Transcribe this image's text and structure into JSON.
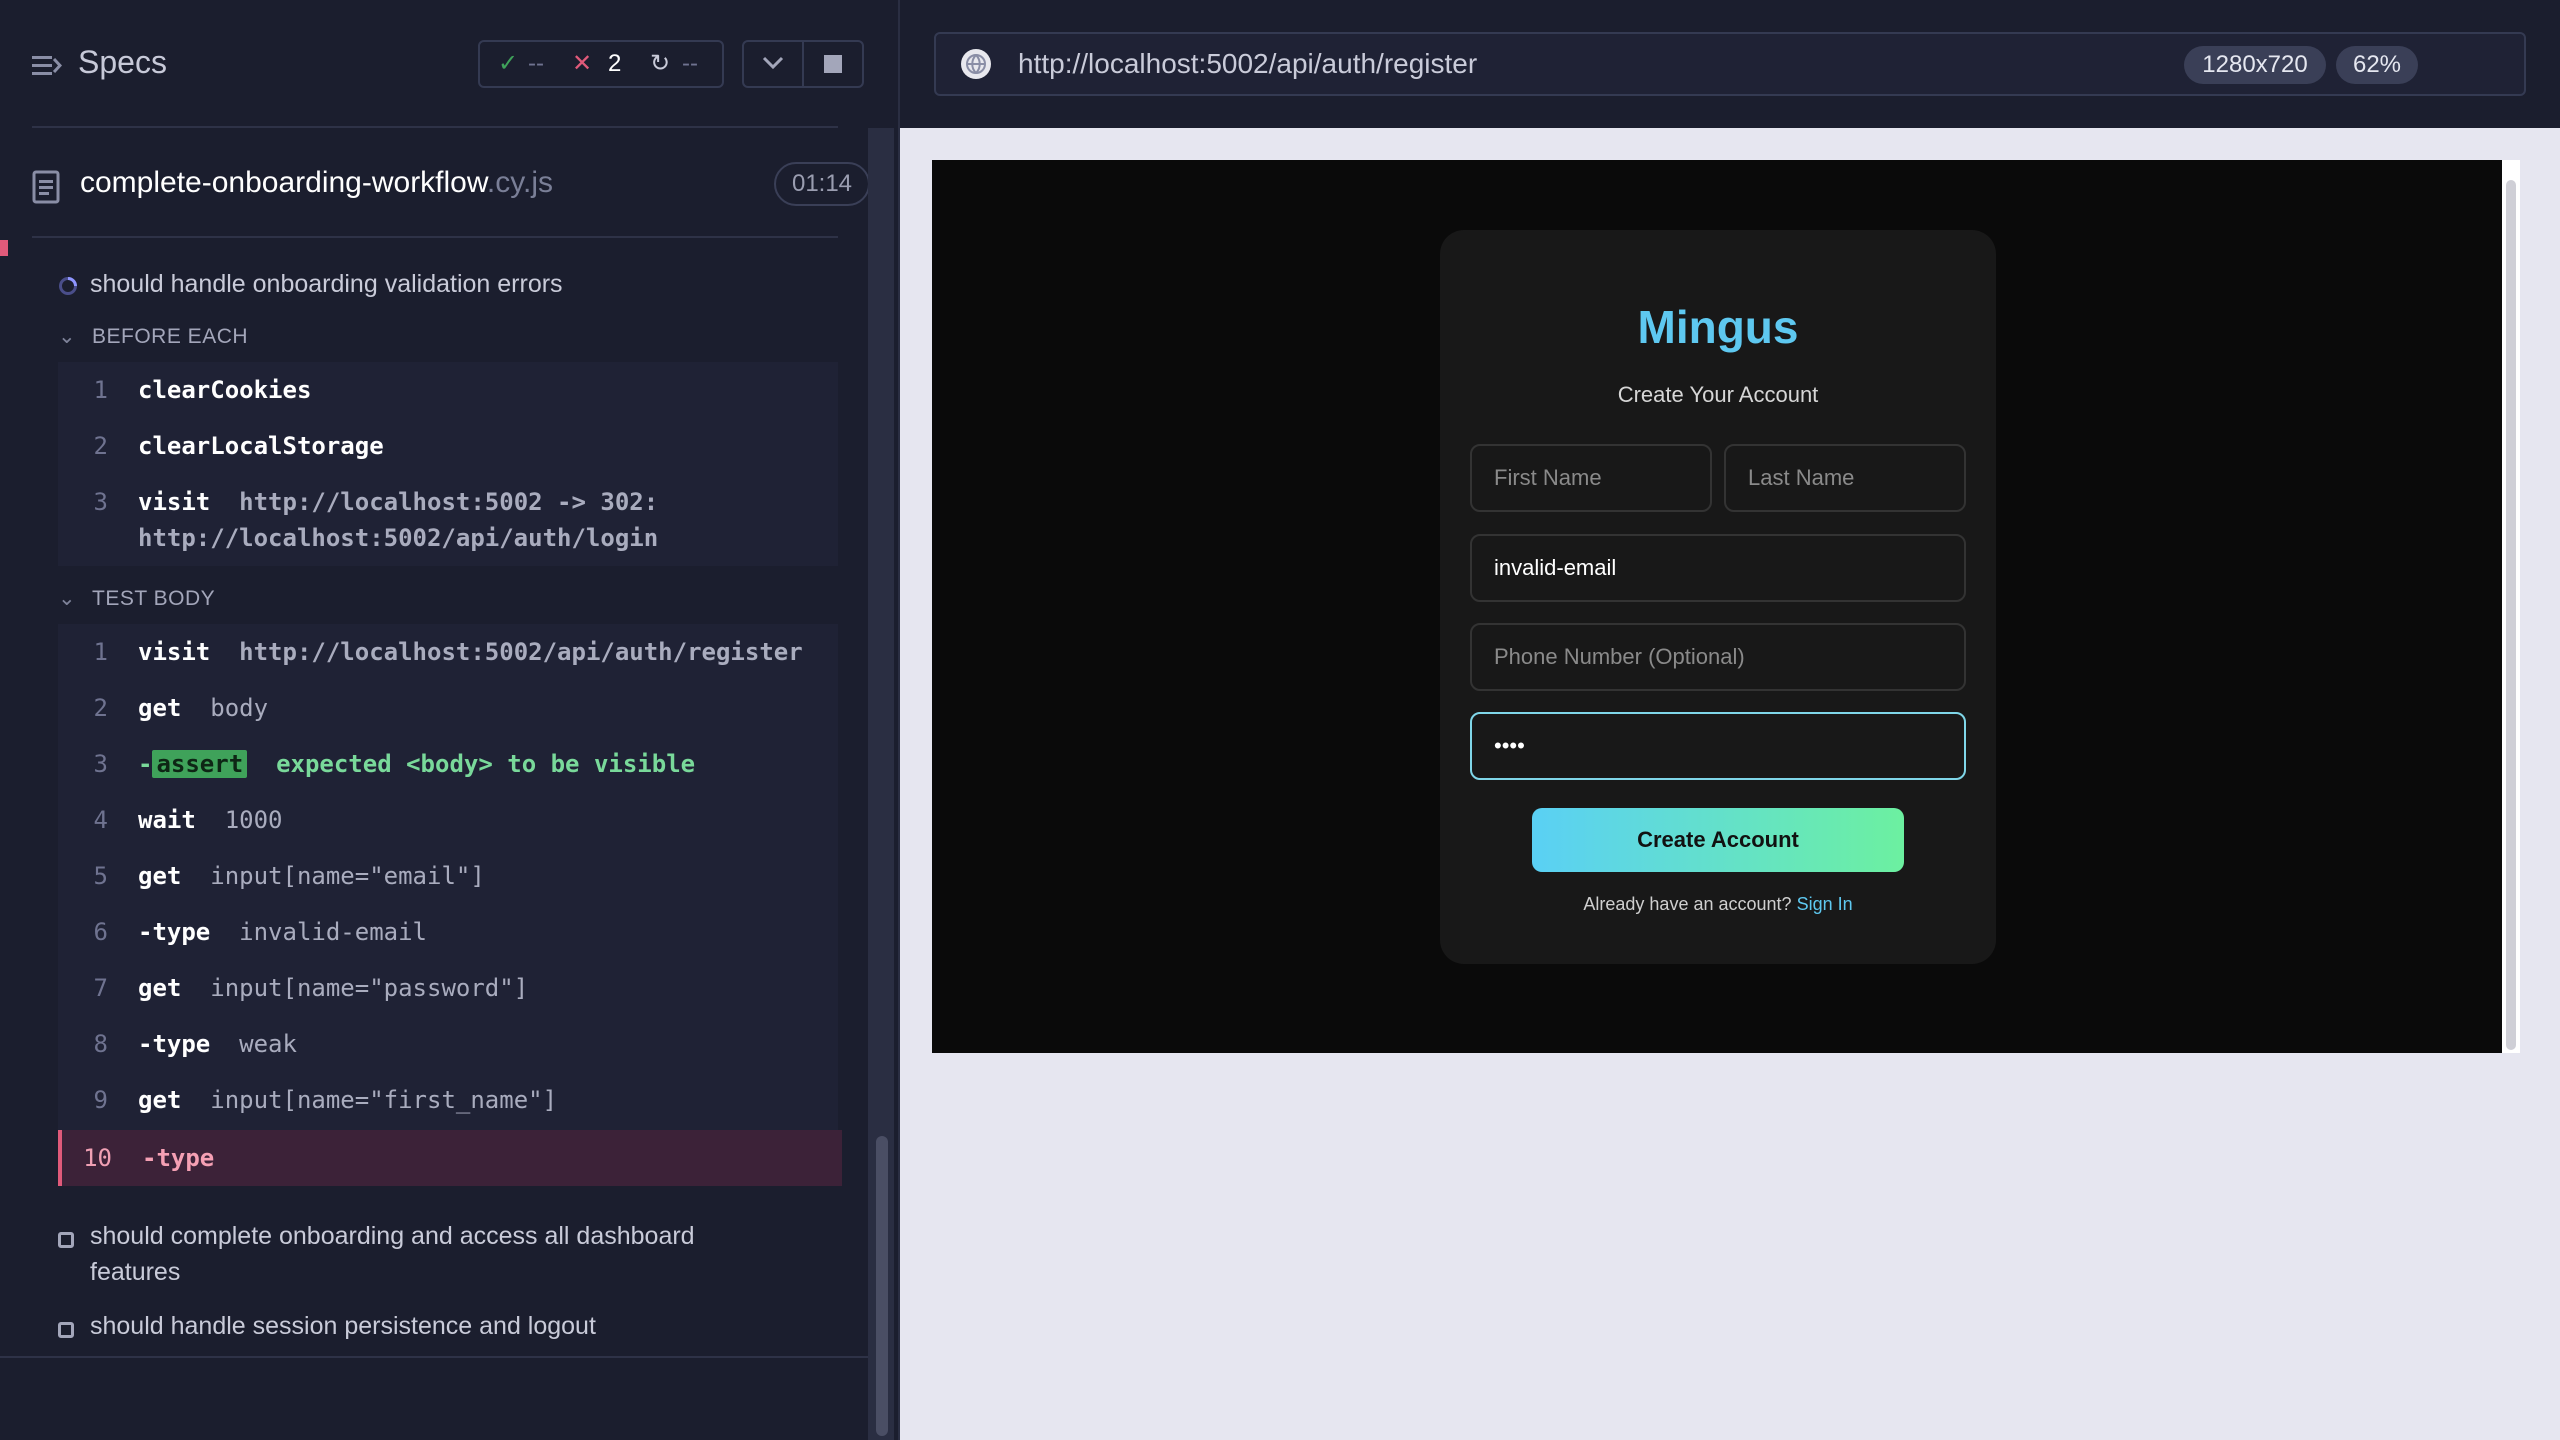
{
  "reporter": {
    "header": {
      "specs_label": "Specs",
      "stats": {
        "passed": "--",
        "failed": "2",
        "pending": "--"
      }
    },
    "spec": {
      "name": "complete-onboarding-workflow",
      "ext": ".cy.js",
      "duration": "01:14"
    },
    "current_test": "should handle onboarding validation errors",
    "before_each": {
      "label": "BEFORE EACH",
      "commands": [
        {
          "num": "1",
          "name": "clearCookies",
          "msg": ""
        },
        {
          "num": "2",
          "name": "clearLocalStorage",
          "msg": ""
        },
        {
          "num": "3",
          "name": "visit",
          "msg": "http://localhost:5002 -> 302:",
          "msg2": "http://localhost:5002/api/auth/login"
        }
      ]
    },
    "test_body": {
      "label": "TEST BODY",
      "commands": [
        {
          "num": "1",
          "name": "visit",
          "msg": "http://localhost:5002/api/auth/register"
        },
        {
          "num": "2",
          "name": "get",
          "msg": "body"
        },
        {
          "num": "3",
          "name": "-assert",
          "tag": "assert",
          "msg": "expected <body> to be visible"
        },
        {
          "num": "4",
          "name": "wait",
          "msg": "1000"
        },
        {
          "num": "5",
          "name": "get",
          "msg": "input[name=\"email\"]"
        },
        {
          "num": "6",
          "name": "-type",
          "msg": "invalid-email"
        },
        {
          "num": "7",
          "name": "get",
          "msg": "input[name=\"password\"]"
        },
        {
          "num": "8",
          "name": "-type",
          "msg": "weak"
        },
        {
          "num": "9",
          "name": "get",
          "msg": "input[name=\"first_name\"]"
        },
        {
          "num": "10",
          "name": "-type",
          "msg": ""
        }
      ]
    },
    "other_tests": [
      {
        "line1": "should complete onboarding and access all dashboard",
        "line2": "features"
      },
      {
        "line1": "should handle session persistence and logout",
        "line2": ""
      }
    ]
  },
  "aut": {
    "url": "http://localhost:5002/api/auth/register",
    "viewport_size": "1280x720",
    "zoom": "62%",
    "app": {
      "brand": "Mingus",
      "subtitle": "Create Your Account",
      "first_name_placeholder": "First Name",
      "last_name_placeholder": "Last Name",
      "email_value": "invalid-email",
      "phone_placeholder": "Phone Number (Optional)",
      "password_value": "weak",
      "create_button": "Create Account",
      "signin_prompt": "Already have an account?",
      "signin_link": "Sign In"
    }
  },
  "colors": {
    "accent": "#5ec8f0",
    "failed": "#e05a7a",
    "passed": "#3fa25a"
  }
}
